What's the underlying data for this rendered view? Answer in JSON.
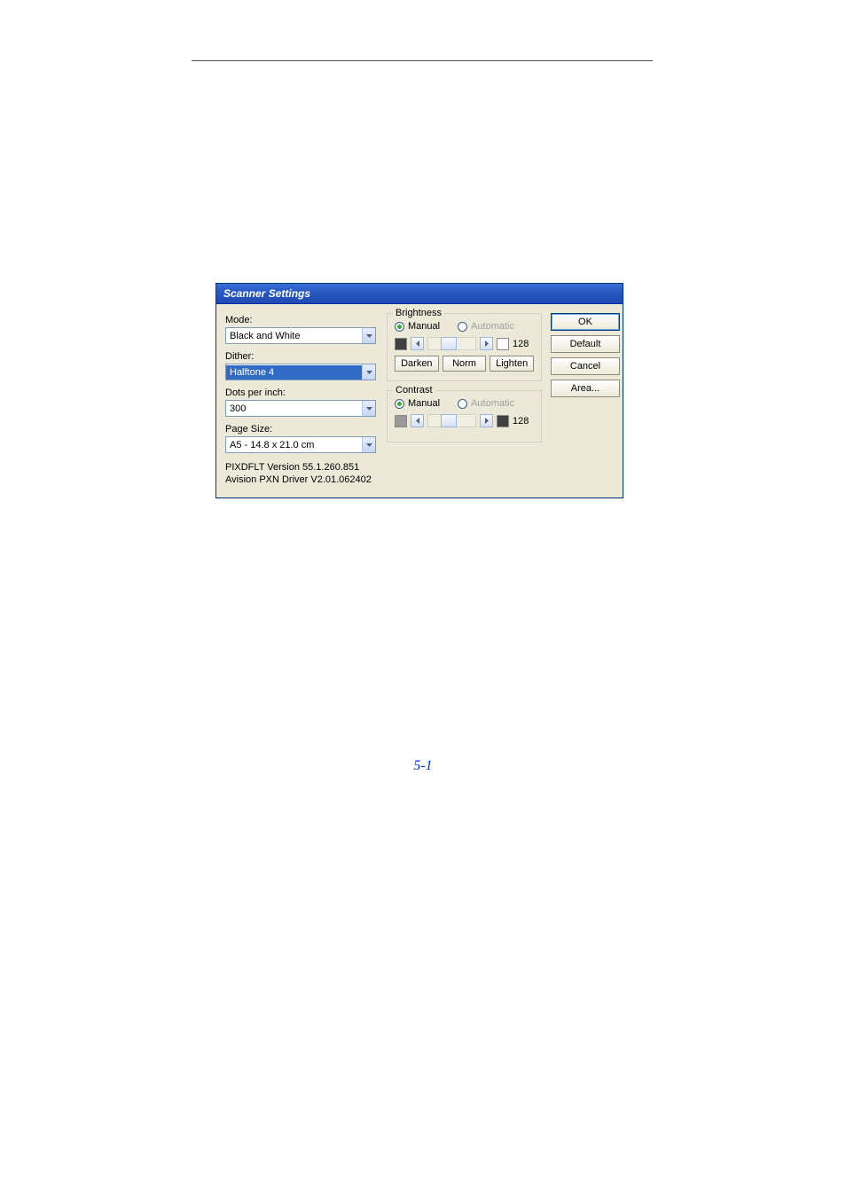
{
  "page_number": "5-1",
  "dialog": {
    "title": "Scanner Settings",
    "left": {
      "mode_label": "Mode:",
      "mode_value": "Black and White",
      "dither_label": "Dither:",
      "dither_value": "Halftone 4",
      "dpi_label": "Dots per inch:",
      "dpi_value": "300",
      "page_size_label": "Page Size:",
      "page_size_value": "A5 - 14.8 x 21.0 cm",
      "version_line1": "PIXDFLT Version 55.1.260.851",
      "version_line2": "Avision PXN Driver V2.01.062402"
    },
    "brightness": {
      "title": "Brightness",
      "manual_label": "Manual",
      "automatic_label": "Automatic",
      "value": "128",
      "darken": "Darken",
      "norm": "Norm",
      "lighten": "Lighten"
    },
    "contrast": {
      "title": "Contrast",
      "manual_label": "Manual",
      "automatic_label": "Automatic",
      "value": "128"
    },
    "buttons": {
      "ok": "OK",
      "default": "Default",
      "cancel": "Cancel",
      "area": "Area..."
    }
  }
}
